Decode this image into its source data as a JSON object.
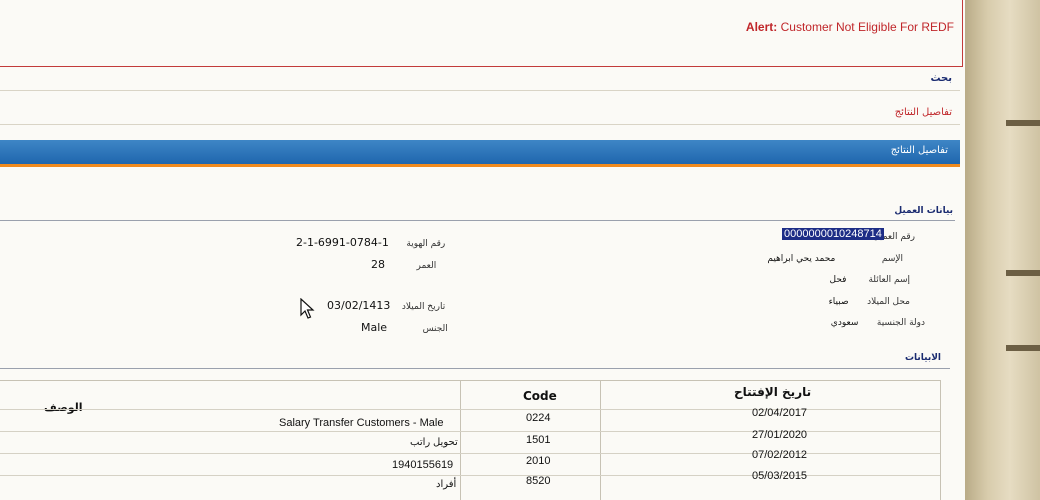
{
  "alert": {
    "label": "Alert:",
    "message": "Customer Not Eligible For REDF"
  },
  "nav": {
    "search": "بحث",
    "results_details": "تفاصيل النتائج"
  },
  "results_header": "تفاصيل النتائج",
  "customer": {
    "section_title": "بيانات العميل",
    "fields_right": [
      {
        "label": "رقم العميل",
        "value": "0000000010248714"
      },
      {
        "label": "الإسم",
        "value": "محمد يحي ابراهيم"
      },
      {
        "label": "إسم العائلة",
        "value": "فحل"
      },
      {
        "label": "محل الميلاد",
        "value": "صبياء"
      },
      {
        "label": "دولة الجنسية",
        "value": "سعودي"
      }
    ],
    "fields_left": [
      {
        "label": "رقم الهوية",
        "value": "2-1-6991-0784-1"
      },
      {
        "label": "العمر",
        "value": "28"
      },
      {
        "label": "تاريخ الميلاد",
        "value": "03/02/1413"
      },
      {
        "label": "الجنس",
        "value": "Male"
      }
    ]
  },
  "products": {
    "section_title": "الابيانات",
    "columns": {
      "open_date": "تاريخ الإفتتاح",
      "code": "Code",
      "description": "الوصف"
    },
    "rows": [
      {
        "open_date": "02/04/2017",
        "code": "0224",
        "description": "Salary Transfer Customers - Male"
      },
      {
        "open_date": "27/01/2020",
        "code": "1501",
        "description": "تحويل راتب"
      },
      {
        "open_date": "07/02/2012",
        "code": "2010",
        "description": "1940155619"
      },
      {
        "open_date": "05/03/2015",
        "code": "8520",
        "description": "أفراد"
      }
    ]
  },
  "colors": {
    "alert_red": "#c0262a",
    "header_blue": "#1f66ad",
    "header_orange": "#f08a1d",
    "selection_blue": "#1d2d86"
  },
  "icons": {
    "cursor": "mouse-pointer-icon"
  }
}
